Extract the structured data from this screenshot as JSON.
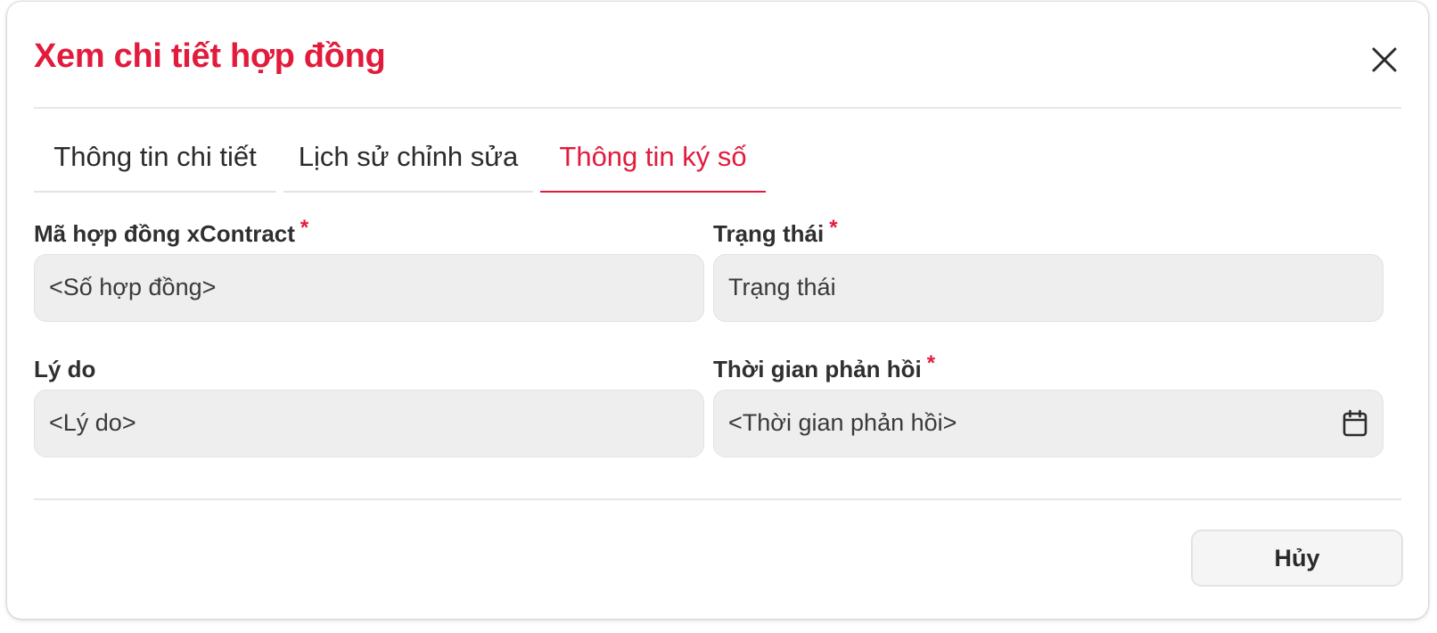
{
  "dialog": {
    "title": "Xem chi tiết hợp đồng",
    "close_icon": "close-icon"
  },
  "tabs": [
    {
      "label": "Thông tin chi tiết",
      "active": false
    },
    {
      "label": "Lịch sử chỉnh sửa",
      "active": false
    },
    {
      "label": "Thông tin ký số",
      "active": true
    }
  ],
  "fields": {
    "contract_code": {
      "label": "Mã hợp đồng xContract",
      "required": true,
      "value": "<Số hợp đồng>"
    },
    "status": {
      "label": "Trạng thái",
      "required": true,
      "value": "Trạng thái"
    },
    "reason": {
      "label": "Lý do",
      "required": false,
      "value": "<Lý do>"
    },
    "response_time": {
      "label": "Thời gian phản hồi",
      "required": true,
      "value": "<Thời gian phản hồi>",
      "icon": "calendar-icon"
    }
  },
  "footer": {
    "cancel_label": "Hủy"
  },
  "colors": {
    "accent": "#e21b3c",
    "input_bg": "#eeeeee",
    "text": "#2f2f2f"
  }
}
